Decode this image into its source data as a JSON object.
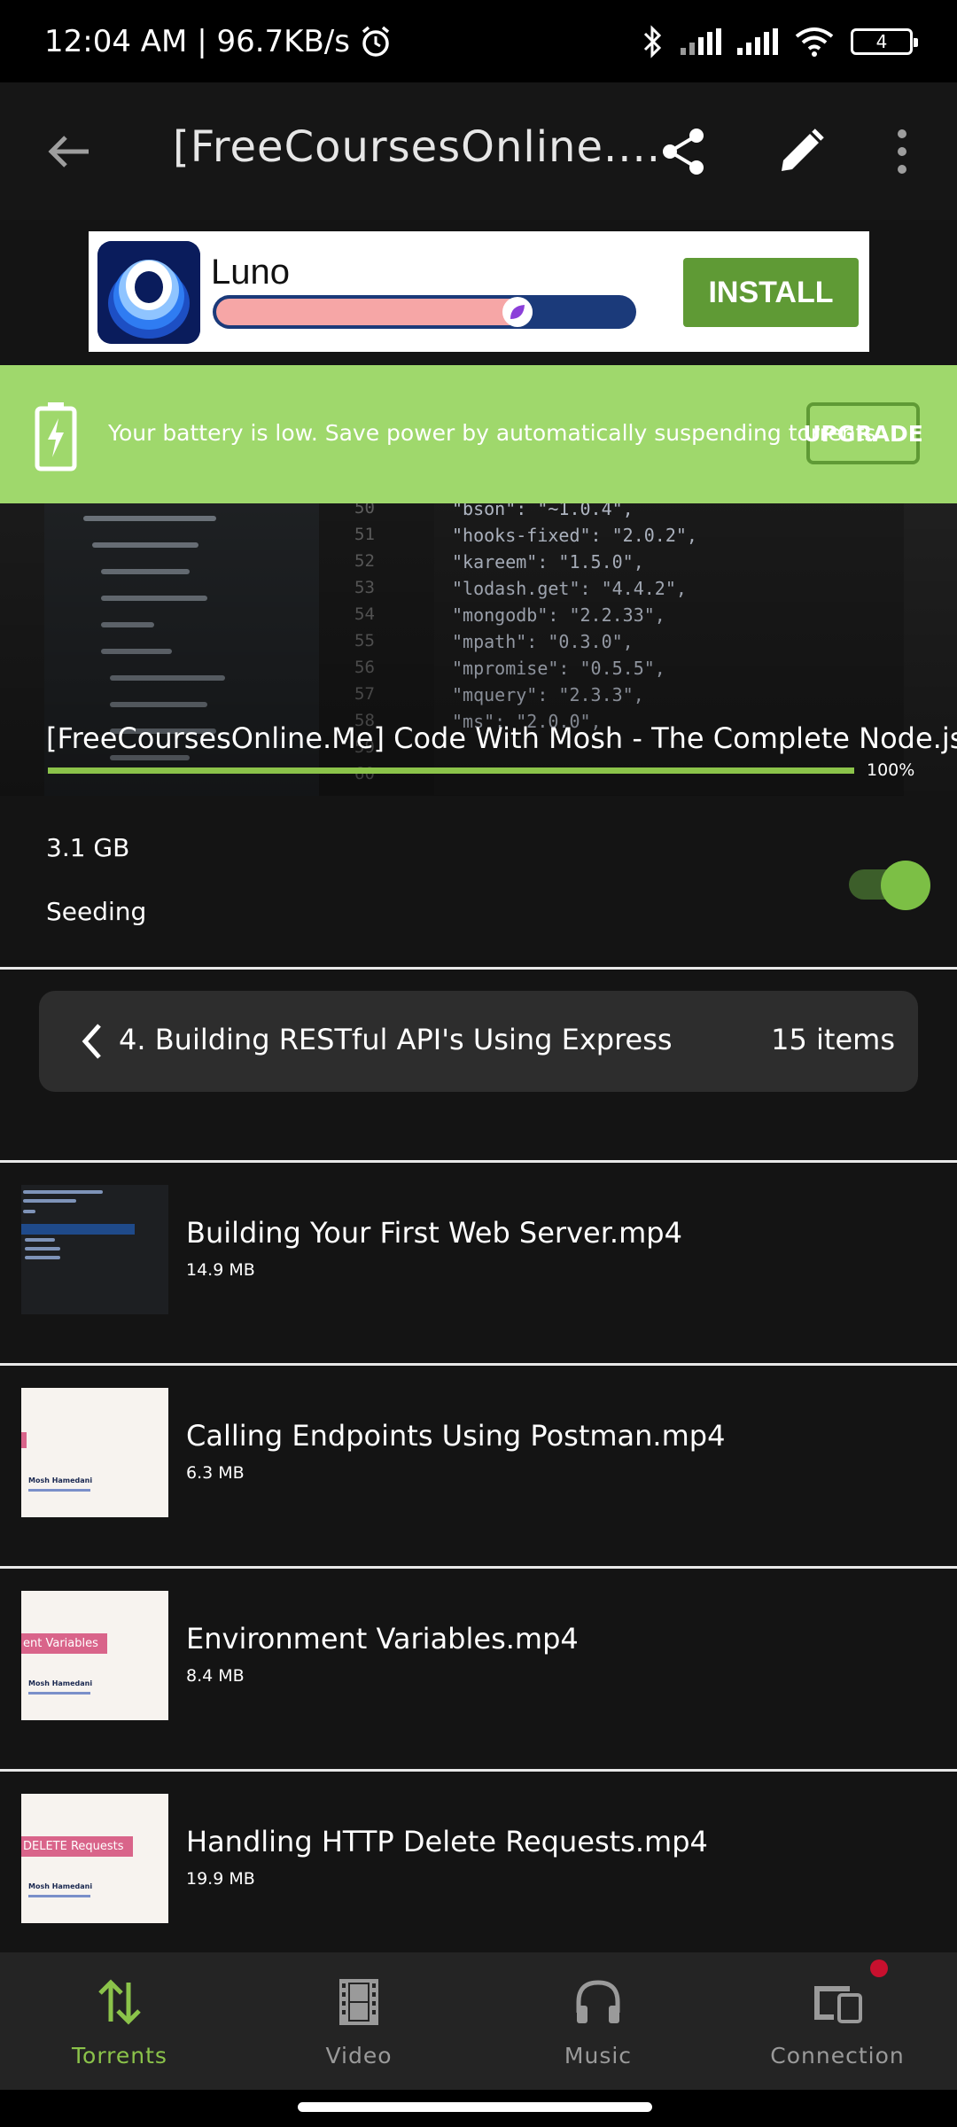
{
  "status_bar": {
    "time_speed": "12:04 AM | 96.7KB/s",
    "battery_level": "4"
  },
  "toolbar": {
    "title": "[FreeCoursesOnline....",
    "icons": [
      "back-arrow-icon",
      "share-icon",
      "edit-pencil-icon",
      "more-vert-icon"
    ]
  },
  "ad": {
    "app_name": "Luno",
    "progress": 0.76,
    "install_label": "INSTALL"
  },
  "battery_notice": {
    "text": "Your battery is low. Save power by automatically suspending torrents",
    "button_label": "UPGRADE"
  },
  "torrent": {
    "name": "[FreeCoursesOnline.Me] Code With Mosh - The Complete Node.js",
    "progress_label": "100%",
    "progress": 1.0,
    "size": "3.1 GB",
    "state": "Seeding",
    "seeding_enabled": true
  },
  "thumbnail_code": {
    "line_numbers": [
      "50",
      "51",
      "52",
      "53",
      "54",
      "55",
      "56",
      "57",
      "58",
      "59",
      "60"
    ],
    "lines": [
      "\"bson\": \"~1.0.4\",",
      "\"hooks-fixed\": \"2.0.2\",",
      "\"kareem\": \"1.5.0\",",
      "\"lodash.get\": \"4.4.2\",",
      "\"mongodb\": \"2.2.33\",",
      "\"mpath\": \"0.3.0\",",
      "\"mpromise\": \"0.5.5\",",
      "\"mquery\": \"2.3.3\",",
      "\"ms\": \"2.0.0\","
    ]
  },
  "folder": {
    "name": "4. Building RESTful API's Using Express",
    "count": "15 items"
  },
  "files": [
    {
      "name": "Building Your First Web Server.mp4",
      "size": "14.9 MB",
      "thumb": "code"
    },
    {
      "name": "Calling Endpoints Using Postman.mp4",
      "size": "6.3 MB",
      "thumb": "slide",
      "tag": ""
    },
    {
      "name": "Environment Variables.mp4",
      "size": "8.4 MB",
      "thumb": "slide",
      "tag": "ent Variables"
    },
    {
      "name": "Handling HTTP Delete Requests.mp4",
      "size": "19.9 MB",
      "thumb": "slide",
      "tag": "DELETE Requests"
    }
  ],
  "slide_author": "Mosh Hamedani",
  "bottom_nav": {
    "items": [
      {
        "label": "Torrents",
        "icon": "up-down-arrows-icon",
        "active": true
      },
      {
        "label": "Video",
        "icon": "film-strip-icon",
        "active": false
      },
      {
        "label": "Music",
        "icon": "headphones-icon",
        "active": false
      },
      {
        "label": "Connection",
        "icon": "devices-icon",
        "active": false,
        "badge": true
      }
    ]
  },
  "colors": {
    "accent": "#8bc34a",
    "notice_bg": "#9fd86c",
    "install_bg": "#5f9a35"
  }
}
